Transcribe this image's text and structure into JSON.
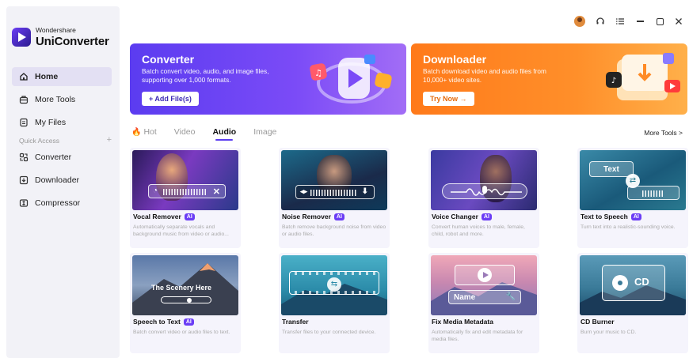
{
  "brand": {
    "company": "Wondershare",
    "product": "UniConverter"
  },
  "sidebar": {
    "items": [
      {
        "label": "Home",
        "active": true,
        "icon": "home-icon"
      },
      {
        "label": "More Tools",
        "active": false,
        "icon": "toolbox-icon"
      },
      {
        "label": "My Files",
        "active": false,
        "icon": "file-icon"
      }
    ],
    "quick_access_label": "Quick Access",
    "quick_access_add": "+",
    "quick_items": [
      {
        "label": "Converter",
        "icon": "converter-icon"
      },
      {
        "label": "Downloader",
        "icon": "downloader-icon"
      },
      {
        "label": "Compressor",
        "icon": "compressor-icon"
      }
    ]
  },
  "window_controls": [
    "avatar-icon",
    "headset-icon",
    "menu-icon",
    "minimize-icon",
    "maximize-icon",
    "close-icon"
  ],
  "banners": {
    "converter": {
      "title": "Converter",
      "description": "Batch convert video, audio, and image files, supporting over 1,000 formats.",
      "button": "+ Add File(s)"
    },
    "downloader": {
      "title": "Downloader",
      "description": "Batch download video and audio files from 10,000+ video sites.",
      "button": "Try Now →"
    }
  },
  "tabs": [
    {
      "label": "Hot",
      "active": false
    },
    {
      "label": "Video",
      "active": false
    },
    {
      "label": "Audio",
      "active": true
    },
    {
      "label": "Image",
      "active": false
    }
  ],
  "more_tools": "More Tools >",
  "ai_badge": "AI",
  "cards": [
    {
      "title": "Vocal Remover",
      "ai": true,
      "description": "Automatically separate vocals and background music from video or audio..."
    },
    {
      "title": "Noise Remover",
      "ai": true,
      "description": "Batch remove background noise from video or audio files."
    },
    {
      "title": "Voice Changer",
      "ai": true,
      "description": "Convert human voices to male, female, child, robot and more."
    },
    {
      "title": "Text to Speech",
      "ai": true,
      "description": "Turn text into a realistic-sounding voice.",
      "overlay": "Text"
    },
    {
      "title": "Speech to Text",
      "ai": true,
      "description": "Batch convert video or audio files to text.",
      "overlay": "The Scenery Here"
    },
    {
      "title": "Transfer",
      "ai": false,
      "description": "Transfer files to your connected device."
    },
    {
      "title": "Fix Media Metadata",
      "ai": false,
      "description": "Automatically fix and edit metadata for media files.",
      "overlay": "Name"
    },
    {
      "title": "CD Burner",
      "ai": false,
      "description": "Burn your music to CD.",
      "overlay": "CD"
    }
  ],
  "colors": {
    "accent": "#5b3cf0",
    "converter_banner": "#6b45f3",
    "downloader_banner": "#ff8a25",
    "sidebar_bg": "#f2f2f7"
  }
}
